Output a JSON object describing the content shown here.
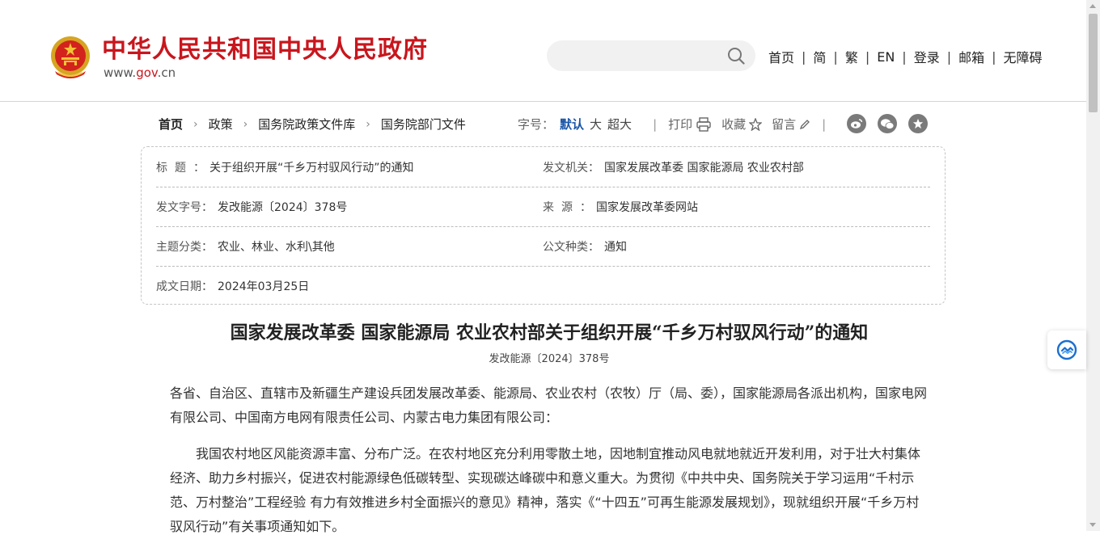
{
  "header": {
    "site_title": "中华人民共和国中央人民政府",
    "domain_prefix": "www.",
    "domain_gov": "gov",
    "domain_suffix": ".cn",
    "search_placeholder": "",
    "nav": [
      "首页",
      "简",
      "繁",
      "EN",
      "登录",
      "邮箱",
      "无障碍"
    ],
    "nav_separator": "|"
  },
  "breadcrumb": {
    "items": [
      "首页",
      "政策",
      "国务院政策文件库",
      "国务院部门文件"
    ],
    "separator": "›"
  },
  "tools": {
    "font_size_label": "字号：",
    "font_sizes": [
      "默认",
      "大",
      "超大"
    ],
    "active_font_size": "默认",
    "divider": "|",
    "print": "打印",
    "favorite": "收藏",
    "comment": "留言",
    "share_icons": [
      "weibo-icon",
      "wechat-icon",
      "star-icon"
    ]
  },
  "info": {
    "title_label": "标题：",
    "title_value": "关于组织开展“千乡万村驭风行动”的通知",
    "issuer_label": "发文机关：",
    "issuer_value": "国家发展改革委  国家能源局  农业农村部",
    "doc_no_label": "发文字号：",
    "doc_no_value": "发改能源〔2024〕378号",
    "source_label": "来源：",
    "source_value": "国家发展改革委网站",
    "topic_label": "主题分类：",
    "topic_value": "农业、林业、水利\\其他",
    "genre_label": "公文种类：",
    "genre_value": "通知",
    "date_label": "成文日期：",
    "date_value": "2024年03月25日"
  },
  "article": {
    "title": "国家发展改革委  国家能源局  农业农村部关于组织开展“千乡万村驭风行动”的通知",
    "doc_number": "发改能源〔2024〕378号",
    "paragraph_1": "各省、自治区、直辖市及新疆生产建设兵团发展改革委、能源局、农业农村（农牧）厅（局、委），国家能源局各派出机构，国家电网有限公司、中国南方电网有限责任公司、内蒙古电力集团有限公司：",
    "paragraph_2": "我国农村地区风能资源丰富、分布广泛。在农村地区充分利用零散土地，因地制宜推动风电就地就近开发利用，对于壮大村集体经济、助力乡村振兴，促进农村能源绿色低碳转型、实现碳达峰碳中和意义重大。为贯彻《中共中央、国务院关于学习运用“千村示范、万村整治”工程经验 有力有效推进乡村全面振兴的意见》精神，落实《“十四五”可再生能源发展规划》，现就组织开展“千乡万村驭风行动”有关事项通知如下。"
  },
  "colors": {
    "brand_red": "#c8161d",
    "link_blue": "#1a56a8",
    "text": "#333333"
  }
}
